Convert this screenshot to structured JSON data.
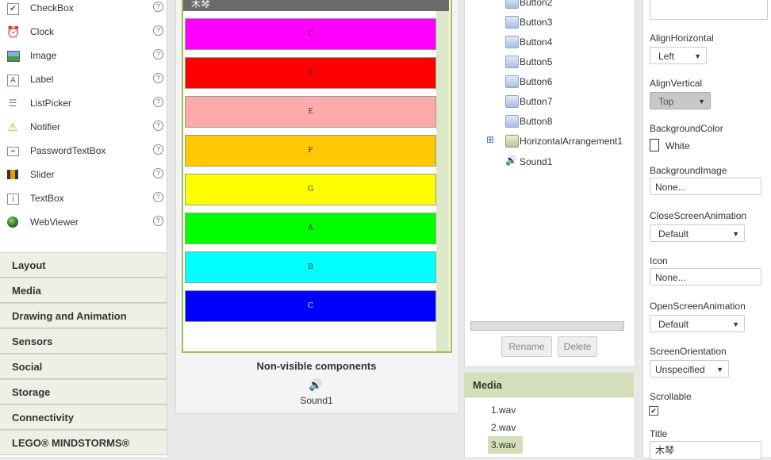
{
  "palette": {
    "items": [
      {
        "label": "CheckBox",
        "icon": "checkbox-icon"
      },
      {
        "label": "Clock",
        "icon": "clock-icon"
      },
      {
        "label": "Image",
        "icon": "image-icon"
      },
      {
        "label": "Label",
        "icon": "label-icon"
      },
      {
        "label": "ListPicker",
        "icon": "listpicker-icon"
      },
      {
        "label": "Notifier",
        "icon": "notifier-icon"
      },
      {
        "label": "PasswordTextBox",
        "icon": "passwordtextbox-icon"
      },
      {
        "label": "Slider",
        "icon": "slider-icon"
      },
      {
        "label": "TextBox",
        "icon": "textbox-icon"
      },
      {
        "label": "WebViewer",
        "icon": "webviewer-icon"
      }
    ],
    "help_glyph": "?",
    "drawers": [
      "Layout",
      "Media",
      "Drawing and Animation",
      "Sensors",
      "Social",
      "Storage",
      "Connectivity",
      "LEGO® MINDSTORMS®"
    ]
  },
  "viewer": {
    "screen_title": "木琴",
    "buttons": [
      {
        "label": "C",
        "color": "#ff00ff"
      },
      {
        "label": "D",
        "color": "#ff0000"
      },
      {
        "label": "E",
        "color": "#ffaaaa"
      },
      {
        "label": "F",
        "color": "#ffc800"
      },
      {
        "label": "G",
        "color": "#ffff00"
      },
      {
        "label": "A",
        "color": "#00ff00"
      },
      {
        "label": "B",
        "color": "#00ffff"
      },
      {
        "label": "C",
        "color": "#0000ff"
      }
    ],
    "nonvisible_title": "Non-visible components",
    "nonvisible_items": [
      "Sound1"
    ]
  },
  "components": {
    "tree": [
      "Button2",
      "Button3",
      "Button4",
      "Button5",
      "Button6",
      "Button7",
      "Button8",
      "HorizontalArrangement1",
      "Sound1"
    ],
    "expand_glyph": "⊞",
    "rename_label": "Rename",
    "delete_label": "Delete"
  },
  "media": {
    "title": "Media",
    "files": [
      "1.wav",
      "2.wav",
      "3.wav"
    ],
    "selected": "3.wav"
  },
  "properties": {
    "align_horizontal_label": "AlignHorizontal",
    "align_horizontal_value": "Left",
    "align_vertical_label": "AlignVertical",
    "align_vertical_value": "Top",
    "background_color_label": "BackgroundColor",
    "background_color_value": "White",
    "background_image_label": "BackgroundImage",
    "background_image_value": "None...",
    "close_anim_label": "CloseScreenAnimation",
    "close_anim_value": "Default",
    "icon_label": "Icon",
    "icon_value": "None...",
    "open_anim_label": "OpenScreenAnimation",
    "open_anim_value": "Default",
    "orientation_label": "ScreenOrientation",
    "orientation_value": "Unspecified",
    "scrollable_label": "Scrollable",
    "scrollable_checked": true,
    "title_label": "Title",
    "title_value": "木琴"
  }
}
